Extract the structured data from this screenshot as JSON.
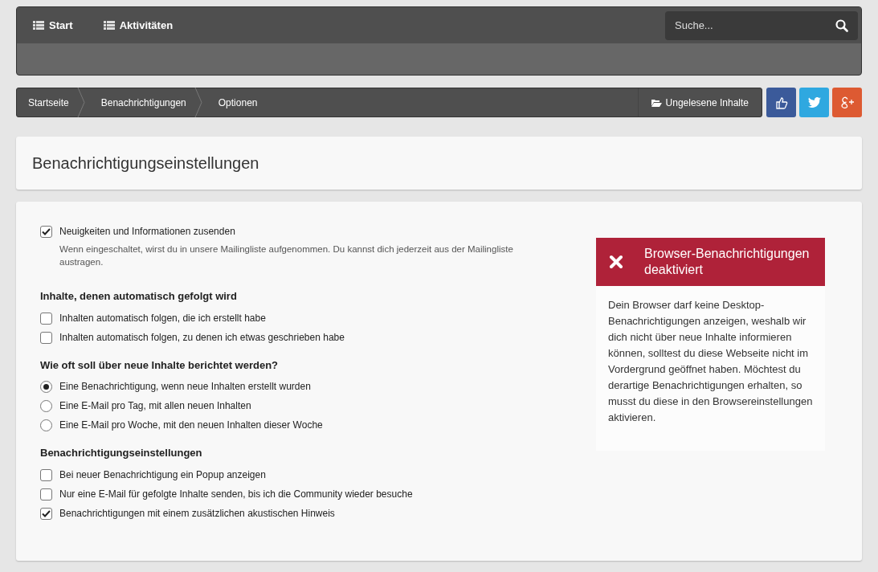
{
  "nav": {
    "items": [
      {
        "label": "Start"
      },
      {
        "label": "Aktivitäten"
      }
    ],
    "search": {
      "placeholder": "Suche..."
    }
  },
  "breadcrumb": [
    {
      "label": "Startseite"
    },
    {
      "label": "Benachrichtigungen"
    },
    {
      "label": "Optionen"
    }
  ],
  "unread_button": {
    "label": "Ungelesene Inhalte"
  },
  "share_buttons": [
    {
      "kind": "like"
    },
    {
      "kind": "twitter"
    },
    {
      "kind": "gplus"
    }
  ],
  "page_title": "Benachrichtigungseinstellungen",
  "options": [
    {
      "kind": "checkbox",
      "label": "Neuigkeiten und Informationen zusenden",
      "checked": true,
      "description": "Wenn eingeschaltet, wirst du in unsere Mailingliste aufgenommen. Du kannst dich jederzeit aus der Mailingliste austragen."
    },
    {
      "kind": "heading",
      "label": "Inhalte, denen automatisch gefolgt wird"
    },
    {
      "kind": "checkbox",
      "label": "Inhalten automatisch folgen, die ich erstellt habe",
      "checked": false
    },
    {
      "kind": "checkbox",
      "label": "Inhalten automatisch folgen, zu denen ich etwas geschrieben habe",
      "checked": false
    },
    {
      "kind": "heading",
      "label": "Wie oft soll über neue Inhalte berichtet werden?"
    },
    {
      "kind": "radio",
      "label": "Eine Benachrichtigung, wenn neue Inhalten erstellt wurden",
      "selected": true
    },
    {
      "kind": "radio",
      "label": "Eine E-Mail pro Tag, mit allen neuen Inhalten",
      "selected": false
    },
    {
      "kind": "radio",
      "label": "Eine E-Mail pro Woche, mit den neuen Inhalten dieser Woche",
      "selected": false
    },
    {
      "kind": "heading",
      "label": "Benachrichtigungseinstellungen"
    },
    {
      "kind": "checkbox",
      "label": "Bei neuer Benachrichtigung ein Popup anzeigen",
      "checked": false
    },
    {
      "kind": "checkbox",
      "label": "Nur eine E-Mail für gefolgte Inhalte senden, bis ich die Community wieder besuche",
      "checked": false
    },
    {
      "kind": "checkbox",
      "label": "Benachrichtigungen mit einem zusätzlichen akustischen Hinweis",
      "checked": true
    }
  ],
  "alert": {
    "title": "Browser-Benachrichtigungen deaktiviert",
    "body": "Dein Browser darf keine Desktop-Benachrichtigungen anzeigen, weshalb wir dich nicht über neue Inhalte informieren können, solltest du diese Webseite nicht im Vordergrund geöffnet haben. Möchtest du derartige Benachrichtigungen erhalten, so musst du diese in den Browsereinstellungen aktivieren."
  }
}
